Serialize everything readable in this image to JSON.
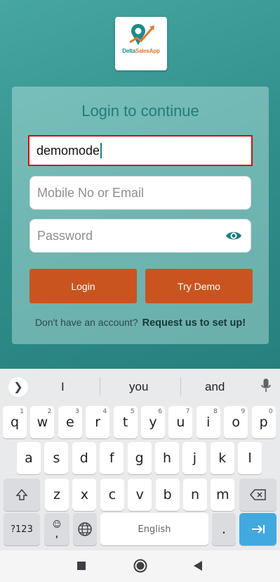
{
  "app": {
    "logo": {
      "part1": "Delta",
      "part2": "SalesApp"
    },
    "card": {
      "title": "Login to continue",
      "active_field_value": "demomode",
      "mobile_placeholder": "Mobile No or Email",
      "password_placeholder": "Password",
      "login_label": "Login",
      "try_demo_label": "Try Demo",
      "signup_question": "Don't have an account?",
      "signup_link": "Request us to set up!"
    },
    "colors": {
      "primary": "#1f7d7c",
      "button": "#c9541f",
      "highlight": "#d40d0d"
    }
  },
  "keyboard": {
    "suggestions": [
      "I",
      "you",
      "and"
    ],
    "row1": [
      {
        "k": "q",
        "n": "1"
      },
      {
        "k": "w",
        "n": "2"
      },
      {
        "k": "e",
        "n": "3"
      },
      {
        "k": "r",
        "n": "4"
      },
      {
        "k": "t",
        "n": "5"
      },
      {
        "k": "y",
        "n": "6"
      },
      {
        "k": "u",
        "n": "7"
      },
      {
        "k": "i",
        "n": "8"
      },
      {
        "k": "o",
        "n": "9"
      },
      {
        "k": "p",
        "n": "0"
      }
    ],
    "row2": [
      "a",
      "s",
      "d",
      "f",
      "g",
      "h",
      "j",
      "k",
      "l"
    ],
    "row3": [
      "z",
      "x",
      "c",
      "v",
      "b",
      "n",
      "m"
    ],
    "row4": {
      "symbols": "?123",
      "comma": ",",
      "space": "English",
      "period": "."
    },
    "icons": {
      "shift": "shift-icon",
      "backspace": "backspace-icon",
      "enter": "enter-arrow-icon",
      "globe": "globe-icon",
      "emoji": "emoji-icon",
      "mic": "mic-icon",
      "expand": "chevron-right-icon"
    }
  },
  "nav": {
    "icons": [
      "recent-apps-icon",
      "home-icon",
      "back-icon"
    ]
  }
}
